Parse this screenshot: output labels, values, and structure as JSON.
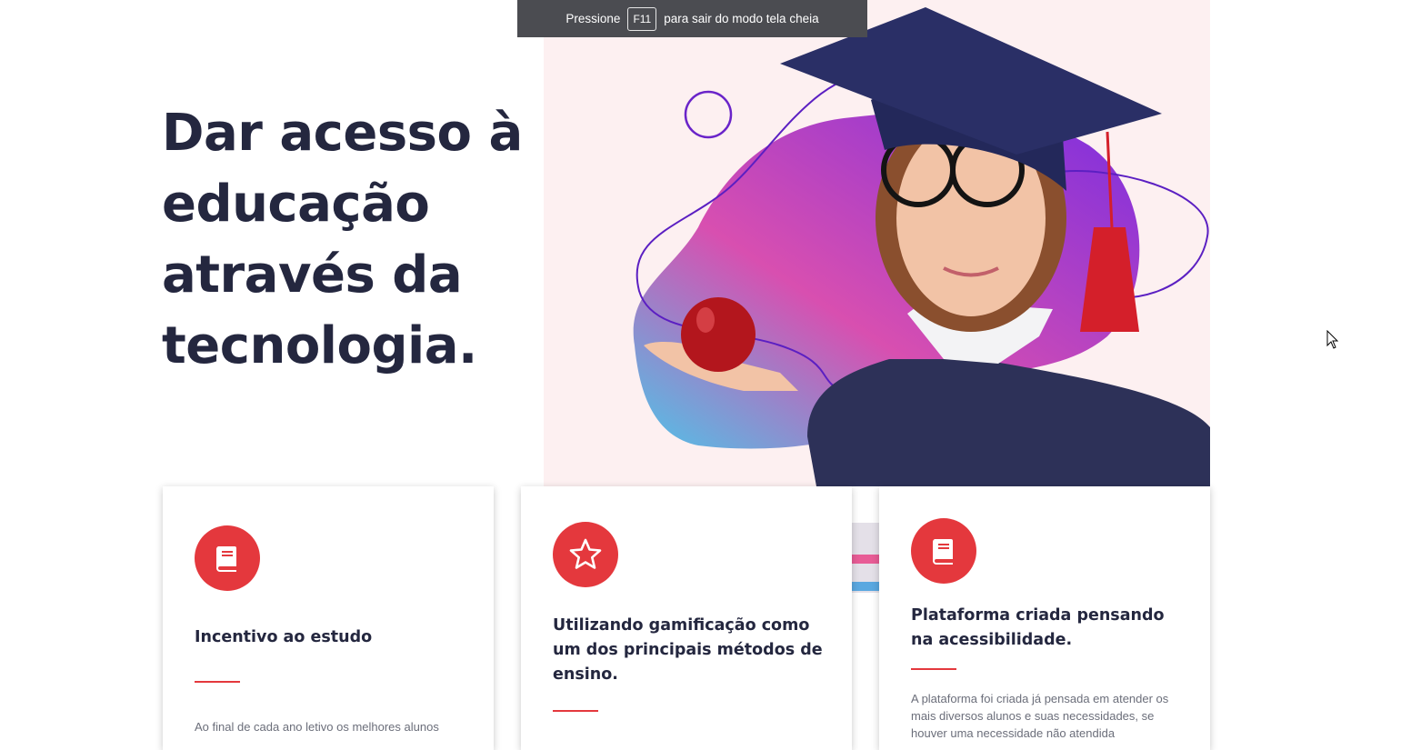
{
  "fullscreen_banner": {
    "prefix": "Pressione",
    "key": "F11",
    "suffix": "para sair do modo tela cheia"
  },
  "hero": {
    "headline": "Dar acesso à educação através da tecnologia."
  },
  "cards": [
    {
      "icon": "book-icon",
      "title": "Incentivo ao estudo",
      "text": "Ao final de cada ano letivo os melhores alunos"
    },
    {
      "icon": "star-icon",
      "title": "Utilizando gamificação como um dos principais métodos de ensino.",
      "text": ""
    },
    {
      "icon": "book-icon",
      "title": "Plataforma criada pensando na acessibilidade.",
      "text": "A plataforma foi criada já pensada em atender os mais diversos alunos e suas necessidades, se houver uma necessidade não atendida"
    }
  ],
  "colors": {
    "accent": "#e4383d",
    "heading": "#24273f",
    "hero_background": "#fdf0f1",
    "banner_background": "#4b4c51"
  }
}
